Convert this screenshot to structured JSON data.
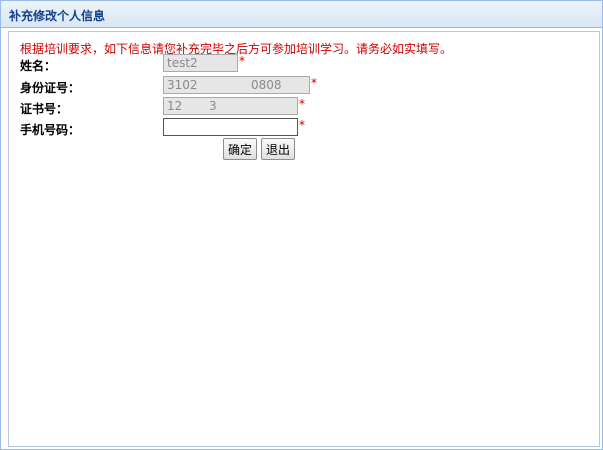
{
  "dialog": {
    "title": "补充修改个人信息"
  },
  "form": {
    "notice": "根据培训要求，如下信息请您补充完毕之后方可参加培训学习。请务必如实填写。",
    "required_mark": "*",
    "fields": [
      {
        "label": "姓名：",
        "value": "test2"
      },
      {
        "label": "身份证号：",
        "value": "3102              0808"
      },
      {
        "label": "证书号：",
        "value": "12       3"
      },
      {
        "label": "手机号码：",
        "value": "",
        "placeholder": ""
      }
    ]
  },
  "buttons": {
    "confirm": "确定",
    "exit": "退出"
  }
}
